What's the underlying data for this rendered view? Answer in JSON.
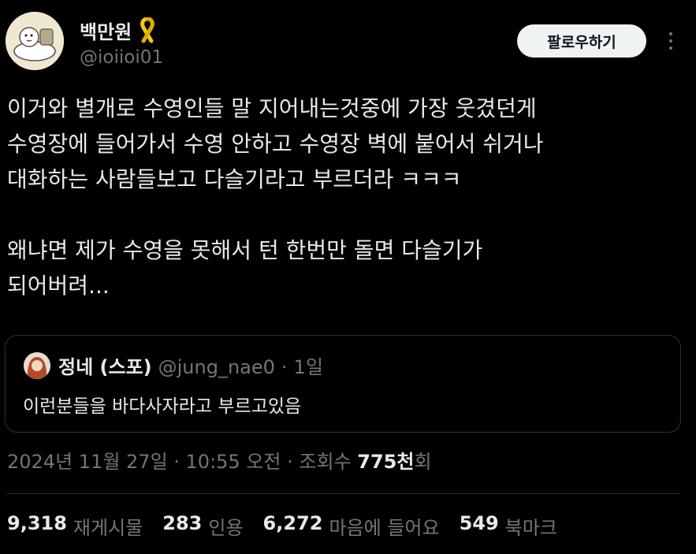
{
  "author": {
    "display_name": "백만원",
    "badge_icon": "yellow-ribbon-icon",
    "handle": "@ioiioi01"
  },
  "follow_button_label": "팔로우하기",
  "more_icon": "more-options-icon",
  "tweet": {
    "lines": [
      "이거와 별개로 수영인들 말 지어내는것중에 가장 웃겼던게",
      "수영장에 들어가서 수영 안하고 수영장 벽에 붙어서 쉬거나",
      "대화하는 사람들보고 다슬기라고 부르더라 ㅋㅋㅋ",
      "",
      "왜냐면 제가 수영을 못해서 턴 한번만 돌면 다슬기가",
      "되어버려..."
    ]
  },
  "quote": {
    "display_name": "정네 (스포)",
    "handle": "@jung_nae0",
    "separator": "·",
    "time": "1일",
    "text": "이런분들을 바다사자라고 부르고있음"
  },
  "meta": {
    "timestamp": "2024년 11월 27일 · 10:55 오전 · 조회수",
    "views_number": "775천",
    "views_suffix": "회"
  },
  "stats": [
    {
      "number": "9,318",
      "label": "재게시물"
    },
    {
      "number": "283",
      "label": "인용"
    },
    {
      "number": "6,272",
      "label": "마음에 들어요"
    },
    {
      "number": "549",
      "label": "북마크"
    }
  ],
  "colors": {
    "background": "#000000",
    "text_primary": "#e7e9ea",
    "text_secondary": "#71767b",
    "border": "#2f3336",
    "follow_button_bg": "#eff3f4",
    "ribbon": "#f5c518"
  }
}
